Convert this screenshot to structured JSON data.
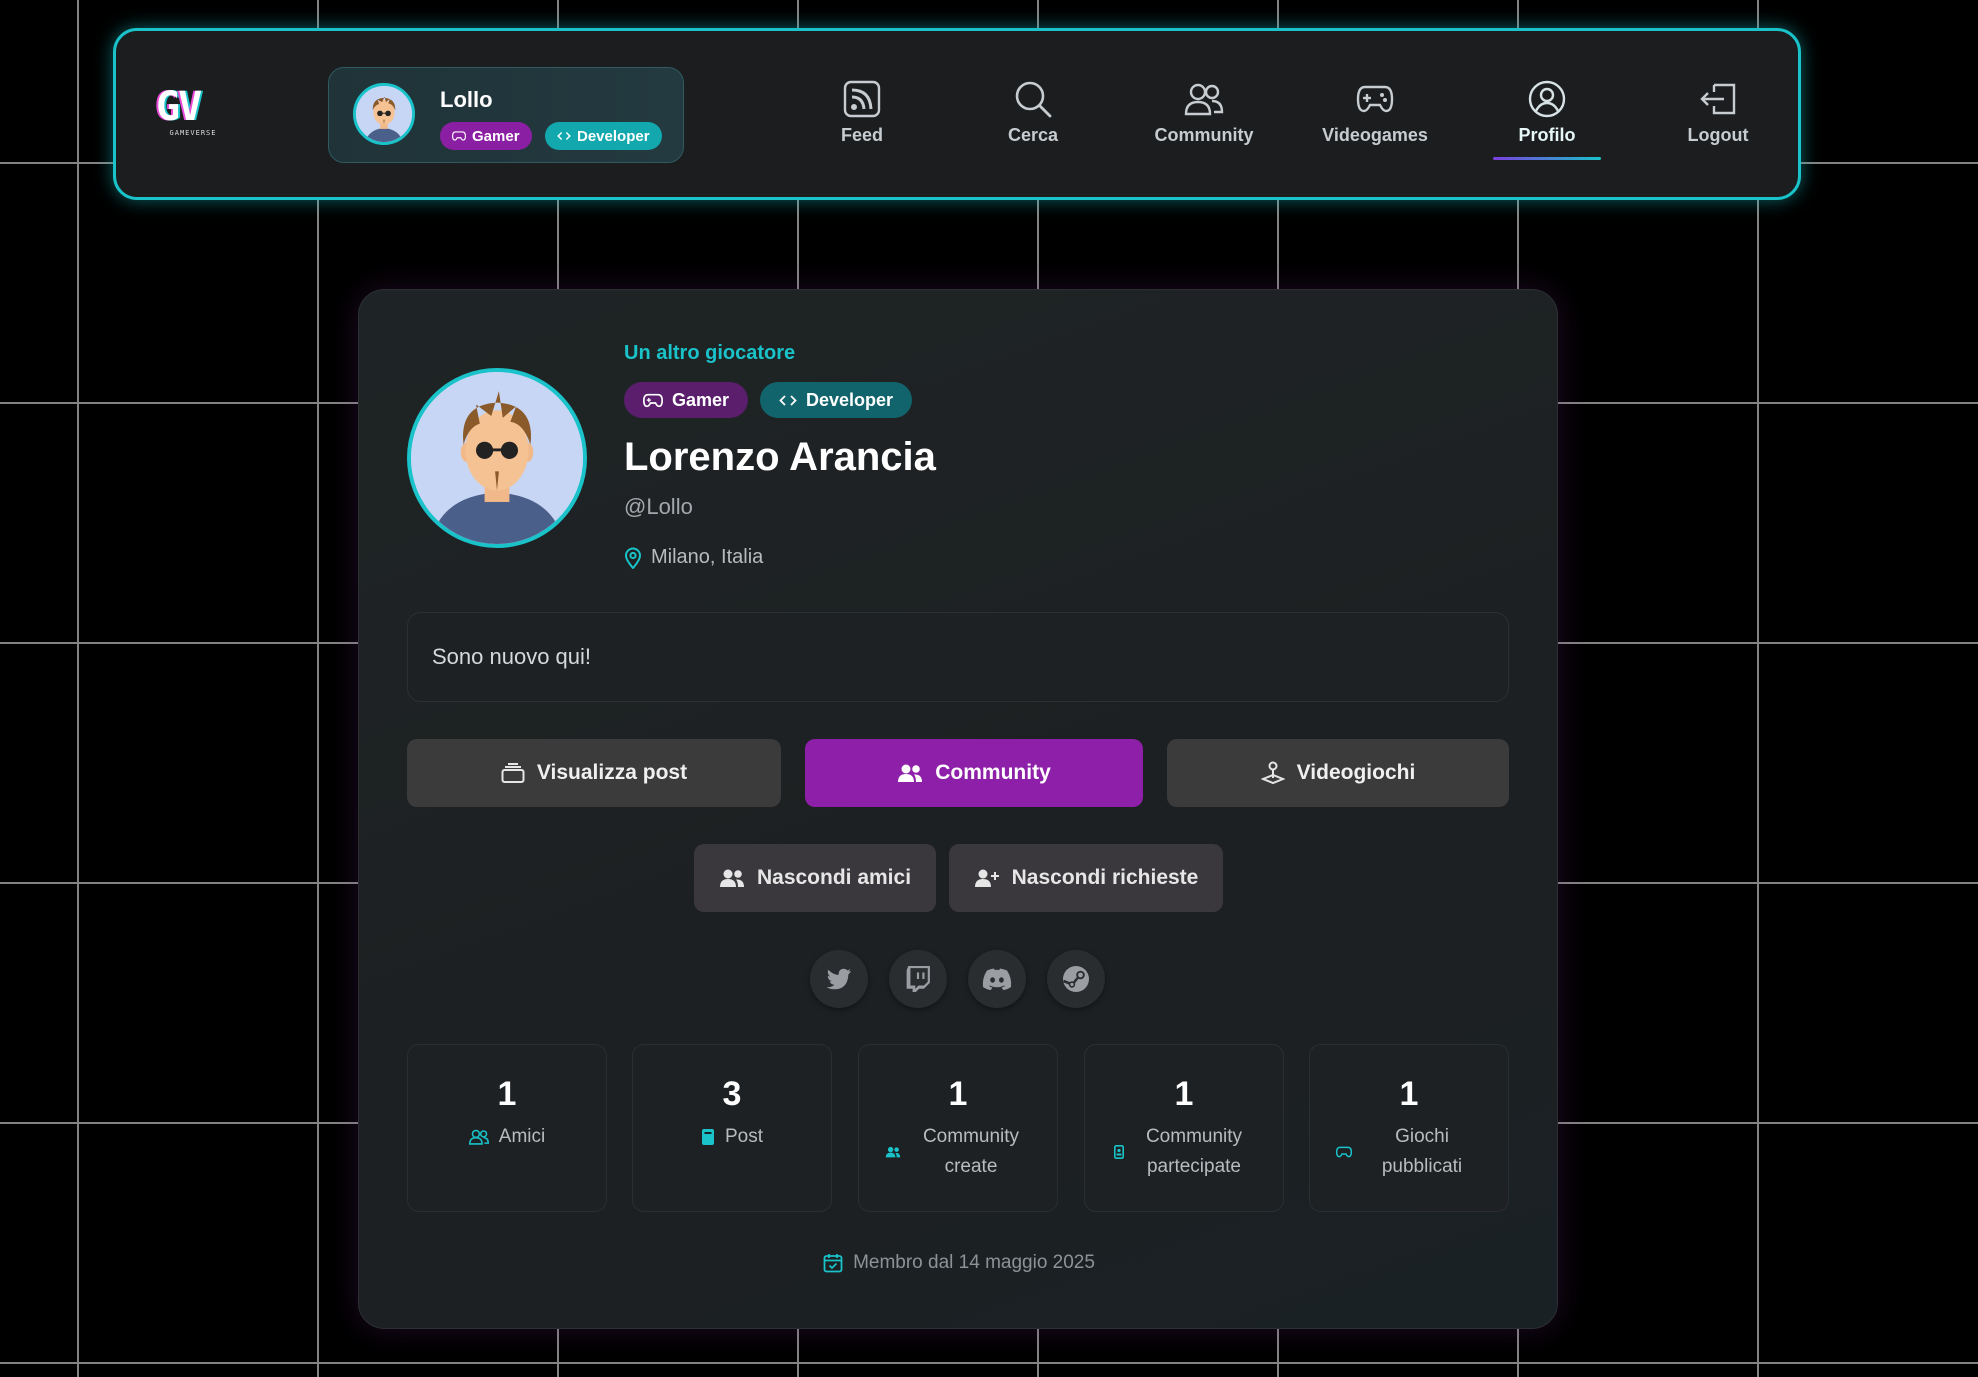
{
  "navbar": {
    "logo_text": "GV",
    "logo_subtext": "GAMEVERSE",
    "user": {
      "name": "Lollo",
      "badges": [
        "Gamer",
        "Developer"
      ]
    },
    "items": [
      {
        "label": "Feed",
        "icon": "rss-icon"
      },
      {
        "label": "Cerca",
        "icon": "search-icon"
      },
      {
        "label": "Community",
        "icon": "users-icon"
      },
      {
        "label": "Videogames",
        "icon": "gamepad-icon"
      },
      {
        "label": "Profilo",
        "icon": "user-circle-icon",
        "active": true
      },
      {
        "label": "Logout",
        "icon": "logout-icon"
      }
    ]
  },
  "profile": {
    "subtitle": "Un altro giocatore",
    "badges": [
      "Gamer",
      "Developer"
    ],
    "full_name": "Lorenzo Arancia",
    "handle": "@Lollo",
    "location": "Milano, Italia",
    "bio": "Sono nuovo qui!",
    "buttons": {
      "posts": "Visualizza post",
      "community": "Community",
      "games": "Videogiochi",
      "hide_friends": "Nascondi amici",
      "hide_requests": "Nascondi richieste"
    },
    "socials": [
      "twitter-icon",
      "twitch-icon",
      "discord-icon",
      "steam-icon"
    ],
    "stats": [
      {
        "value": "1",
        "label": "Amici",
        "icon": "users-icon"
      },
      {
        "value": "3",
        "label": "Post",
        "icon": "document-icon"
      },
      {
        "value": "1",
        "label": "Community create",
        "icon": "users-icon"
      },
      {
        "value": "1",
        "label": "Community partecipate",
        "icon": "badge-icon"
      },
      {
        "value": "1",
        "label": "Giochi pubblicati",
        "icon": "gamepad-icon"
      }
    ],
    "member_since": "Membro dal 14 maggio 2025"
  },
  "colors": {
    "accent": "#19c3c9",
    "purple": "#8e1fa8",
    "background": "#000000",
    "card": "#1d2022"
  }
}
